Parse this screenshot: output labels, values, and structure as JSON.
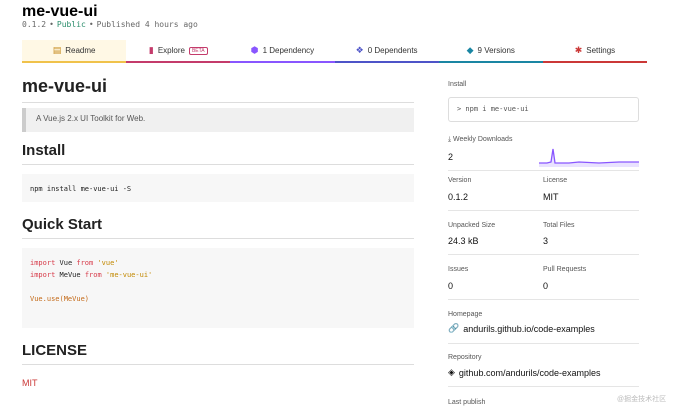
{
  "package": {
    "name": "me-vue-ui",
    "version": "0.1.2",
    "visibility": "Public",
    "published": "Published 4 hours ago"
  },
  "tabs": [
    {
      "label": "Readme",
      "icon": "readme-icon",
      "color": "#c5891b"
    },
    {
      "label": "Explore",
      "badge": "BETA",
      "icon": "explore-icon",
      "color": "#c43b6b"
    },
    {
      "label": "1 Dependency",
      "icon": "box-icon",
      "color": "#8956ff"
    },
    {
      "label": "0 Dependents",
      "icon": "boxes-icon",
      "color": "#4e54c8"
    },
    {
      "label": "9 Versions",
      "icon": "tag-icon",
      "color": "#1a86a3"
    },
    {
      "label": "Settings",
      "icon": "gear-icon",
      "color": "#cb3837"
    }
  ],
  "readme": {
    "title": "me-vue-ui",
    "description": "A Vue.js 2.x UI Toolkit for Web.",
    "install_heading": "Install",
    "install_code": "npm install me-vue-ui -S",
    "quickstart_heading": "Quick Start",
    "code_line1_kw": "import",
    "code_line1_name": " Vue ",
    "code_line1_from": "from",
    "code_line1_str": " 'vue'",
    "code_line2_kw": "import",
    "code_line2_name": " MeVue ",
    "code_line2_from": "from",
    "code_line2_str": " 'me-vue-ui'",
    "code_line3": "Vue.use(MeVue)",
    "license_heading": "LICENSE",
    "license_text": "MIT"
  },
  "sidebar": {
    "install_label": "Install",
    "install_cmd": "> npm i me-vue-ui",
    "weekly_label": "Weekly Downloads",
    "weekly_value": "2",
    "version_label": "Version",
    "version_value": "0.1.2",
    "license_label": "License",
    "license_value": "MIT",
    "unpacked_label": "Unpacked Size",
    "unpacked_value": "24.3 kB",
    "files_label": "Total Files",
    "files_value": "3",
    "issues_label": "Issues",
    "issues_value": "0",
    "pulls_label": "Pull Requests",
    "pulls_value": "0",
    "homepage_label": "Homepage",
    "homepage_value": "andurils.github.io/code-examples",
    "repo_label": "Repository",
    "repo_value": "github.com/andurils/code-examples",
    "last_publish_label": "Last publish",
    "accent": "#8956ff"
  },
  "watermark": "@掘金技术社区"
}
